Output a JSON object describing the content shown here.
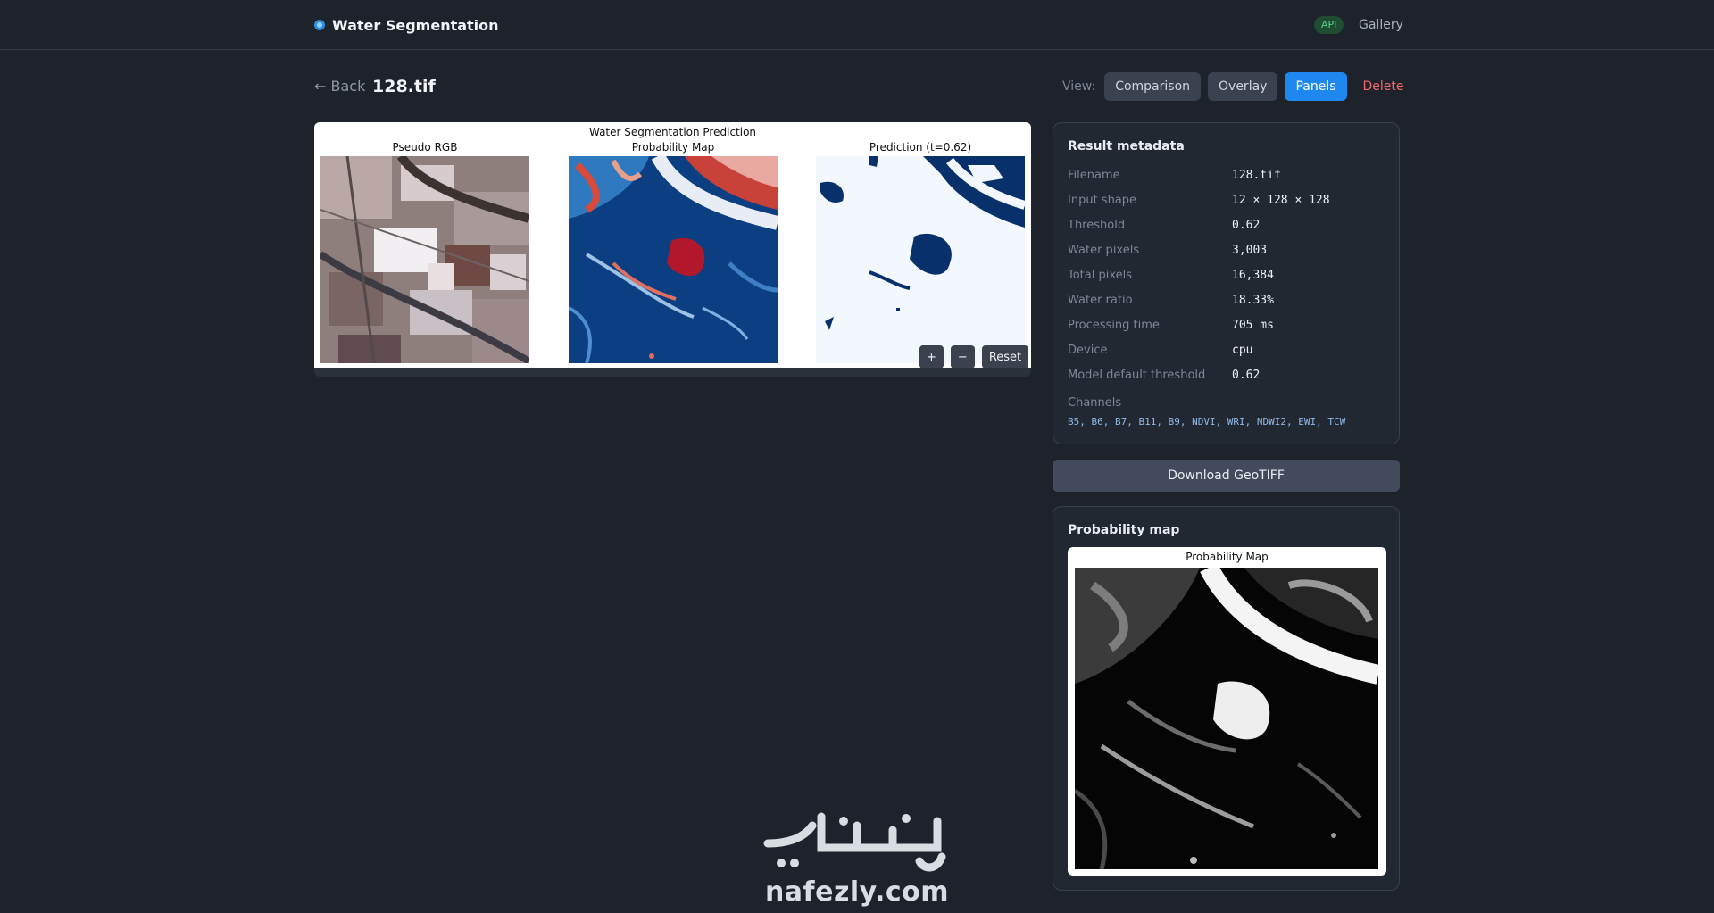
{
  "header": {
    "brand": "Water Segmentation",
    "api_badge": "API",
    "gallery": "Gallery"
  },
  "toolbar": {
    "back": "← Back",
    "filename": "128.tif",
    "view_label": "View:",
    "views": [
      "Comparison",
      "Overlay",
      "Panels"
    ],
    "active_view": "Panels",
    "delete": "Delete"
  },
  "figure": {
    "suptitle": "Water Segmentation Prediction",
    "panels": [
      "Pseudo RGB",
      "Probability Map",
      "Prediction (t=0.62)"
    ],
    "tools": {
      "zoom_in": "+",
      "zoom_out": "−",
      "reset": "Reset"
    }
  },
  "metadata": {
    "title": "Result metadata",
    "rows": [
      {
        "key": "Filename",
        "value": "128.tif"
      },
      {
        "key": "Input shape",
        "value": "12 × 128 × 128"
      },
      {
        "key": "Threshold",
        "value": "0.62"
      },
      {
        "key": "Water pixels",
        "value": "3,003"
      },
      {
        "key": "Total pixels",
        "value": "16,384"
      },
      {
        "key": "Water ratio",
        "value": "18.33%"
      },
      {
        "key": "Processing time",
        "value": "705 ms"
      },
      {
        "key": "Device",
        "value": "cpu"
      },
      {
        "key": "Model default threshold",
        "value": "0.62"
      }
    ],
    "channels_label": "Channels",
    "channels": "B5, B6, B7, B11, B9, NDVI, WRI, NDWI2, EWI, TCW"
  },
  "download": {
    "label": "Download GeoTIFF"
  },
  "probability_card": {
    "title": "Probability map",
    "figure_title": "Probability Map"
  },
  "watermark": {
    "logo_text": "نفذلي",
    "text": "nafezly.com"
  },
  "colors": {
    "background": "#1d222b",
    "accent": "#1f87f0",
    "danger": "#f36a6a",
    "api_green": "#57d28a",
    "water_blue": "#08306b"
  }
}
